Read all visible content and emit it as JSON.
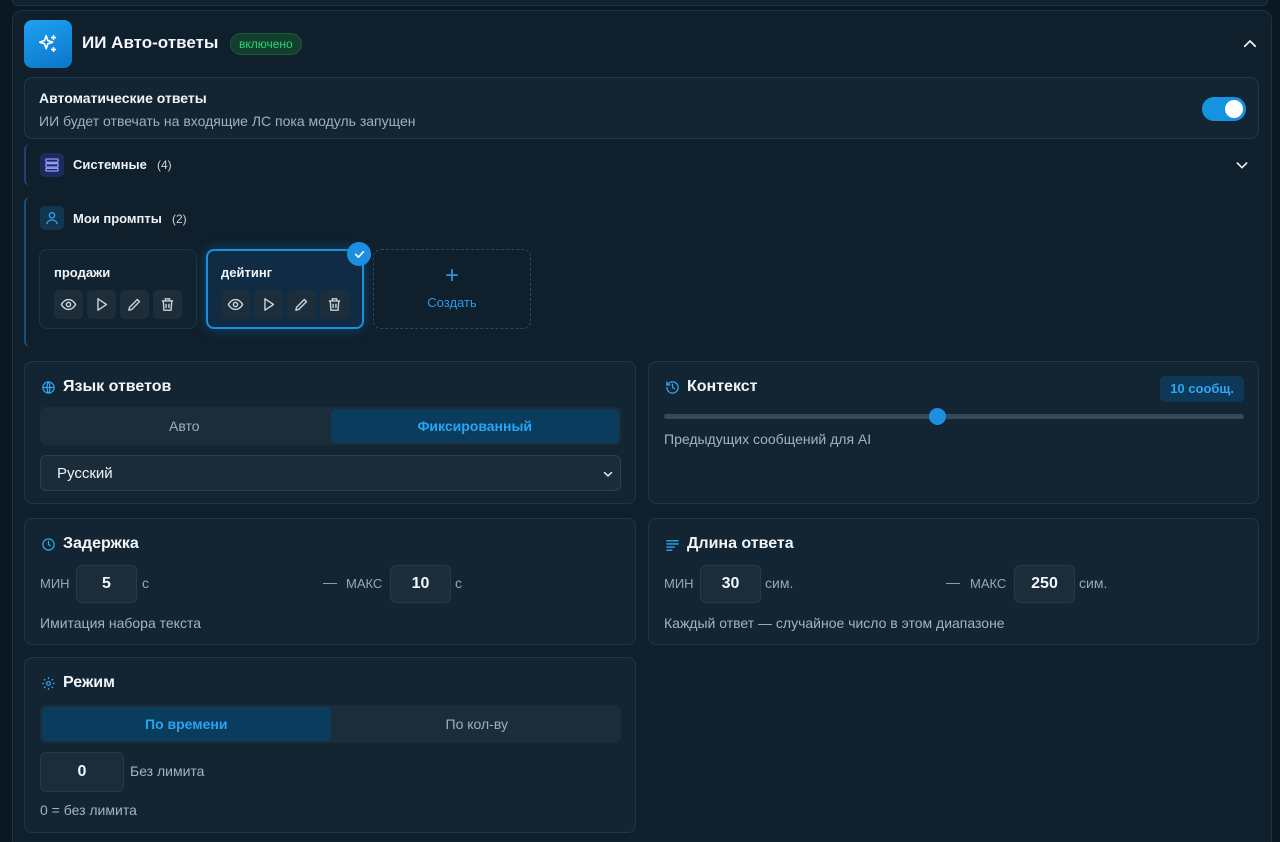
{
  "header": {
    "title": "ИИ Авто-ответы",
    "status_badge": "включено"
  },
  "auto_replies": {
    "title": "Автоматические ответы",
    "description": "ИИ будет отвечать на входящие ЛС пока модуль запущен",
    "enabled": true
  },
  "system_prompts": {
    "label": "Системные",
    "count": "(4)"
  },
  "my_prompts": {
    "label": "Мои промпты",
    "count": "(2)",
    "items": [
      {
        "name": "продажи",
        "selected": false
      },
      {
        "name": "дейтинг",
        "selected": true
      }
    ],
    "create_label": "Создать"
  },
  "language": {
    "title": "Язык ответов",
    "options": [
      "Авто",
      "Фиксированный"
    ],
    "active_option": "Фиксированный",
    "selected_language": "Русский"
  },
  "context": {
    "title": "Контекст",
    "badge": "10 сообщ.",
    "slider_fraction": 0.47,
    "description": "Предыдущих сообщений для AI"
  },
  "delay": {
    "title": "Задержка",
    "min_label": "МИН",
    "min_value": "5",
    "min_unit": "с",
    "dash": "—",
    "max_label": "МАКС",
    "max_value": "10",
    "max_unit": "с",
    "description": "Имитация набора текста"
  },
  "length": {
    "title": "Длина ответа",
    "min_label": "МИН",
    "min_value": "30",
    "min_unit": "сим.",
    "dash": "—",
    "max_label": "МАКС",
    "max_value": "250",
    "max_unit": "сим.",
    "description": "Каждый ответ — случайное число в этом диапазоне"
  },
  "mode": {
    "title": "Режим",
    "options": [
      "По времени",
      "По кол-ву"
    ],
    "active_option": "По времени",
    "limit_value": "0",
    "limit_label": "Без лимита",
    "hint": "0 = без лимита"
  },
  "colors": {
    "accent": "#1d8fe0",
    "success": "#2fd37a",
    "background": "#0f1f2c"
  }
}
